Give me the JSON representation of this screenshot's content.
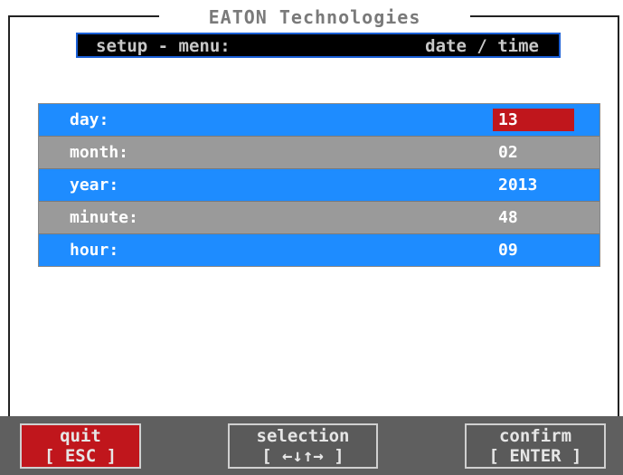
{
  "header": {
    "brand": "EATON Technologies",
    "menu_left": "setup - menu:",
    "menu_right": "date / time"
  },
  "fields": [
    {
      "label": "day:",
      "value": "13"
    },
    {
      "label": "month:",
      "value": "02"
    },
    {
      "label": "year:",
      "value": "2013"
    },
    {
      "label": "minute:",
      "value": "48"
    },
    {
      "label": "hour:",
      "value": "09"
    }
  ],
  "footer": {
    "quit": {
      "label": "quit",
      "key": "[ ESC ]"
    },
    "selection": {
      "label": "selection",
      "key": "[ ←↓↑→ ]"
    },
    "confirm": {
      "label": "confirm",
      "key": "[ ENTER ]"
    }
  },
  "colors": {
    "row_blue": "#1e8cff",
    "row_gray": "#9a9a9a",
    "active_red": "#c0161c",
    "menu_border": "#1a5fd6"
  }
}
